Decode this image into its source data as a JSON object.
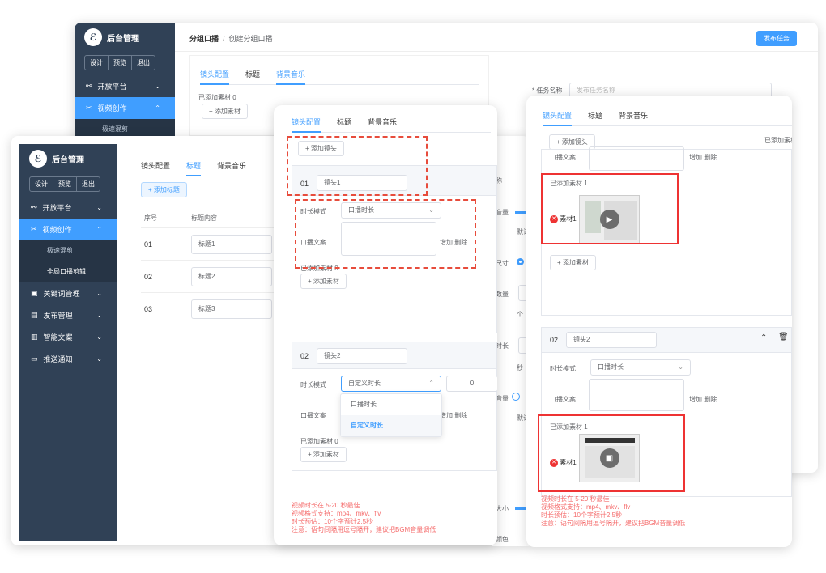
{
  "app": {
    "brand": "后台管理",
    "logo_glyph": "ℰ",
    "btns": [
      "设计",
      "预览",
      "退出"
    ]
  },
  "menu": {
    "items": [
      {
        "label": "开放平台",
        "icon": "share-icon"
      },
      {
        "label": "视频创作",
        "icon": "scissors-icon"
      },
      {
        "label": "关键词管理",
        "icon": "image-icon"
      },
      {
        "label": "发布管理",
        "icon": "clipboard-icon"
      },
      {
        "label": "智能文案",
        "icon": "book-icon"
      },
      {
        "label": "推送通知",
        "icon": "message-icon"
      }
    ],
    "sub": [
      "极速混剪",
      "全局口播剪辑"
    ]
  },
  "back": {
    "breadcrumb": [
      "分组口播",
      "创建分组口播"
    ],
    "publish": "发布任务",
    "task_label": "* 任务名称",
    "task_placeholder": "发布任务名称"
  },
  "tabs": [
    "镜头配置",
    "标题",
    "背景音乐"
  ],
  "added0": "已添加素材 0",
  "added1": "已添加素材 1",
  "add_material": "+ 添加素材",
  "add_shot": "+ 添加镜头",
  "add_title": "+ 添加标题",
  "title_table": {
    "headers": [
      "序号",
      "标题内容"
    ],
    "rows": [
      [
        "01",
        "标题1"
      ],
      [
        "02",
        "标题2"
      ],
      [
        "03",
        "标题3"
      ]
    ]
  },
  "shot1": {
    "no": "01",
    "name": "镜头1"
  },
  "shot2": {
    "no": "02",
    "name": "镜头2"
  },
  "duration_mode": "时长模式",
  "mode_voice": "口播时长",
  "mode_custom": "自定义时长",
  "script_label": "口播文案",
  "add_delete": "增加 删除",
  "custom_value": "0",
  "material": "素材1",
  "stubs": [
    "称",
    "音量",
    "默认",
    "尺寸",
    "数量",
    "个",
    "时长",
    "2",
    "秒",
    "音量",
    "默认",
    "大小",
    "颜色",
    "1"
  ],
  "notes": [
    "视频时长在 5-20 秒最佳",
    "视频格式支持：mp4、mkv、flv",
    "时长预估：10个字预计2.5秒",
    "注意：语句间隔用逗号隔开，建议把BGM音量调低"
  ],
  "colors": {
    "sidebar": "#304156",
    "accent": "#409eff",
    "warn": "#e74c3c"
  }
}
